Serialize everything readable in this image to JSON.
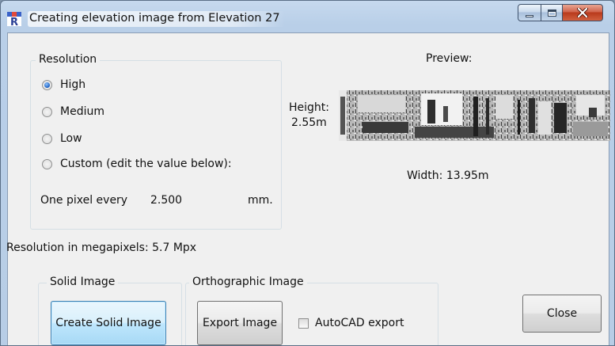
{
  "window": {
    "title": "Creating elevation image from Elevation 27",
    "controls": {
      "minimize": "minimize",
      "maximize": "maximize",
      "close": "close"
    }
  },
  "resolution": {
    "legend": "Resolution",
    "options": [
      {
        "label": "High",
        "selected": true
      },
      {
        "label": "Medium",
        "selected": false
      },
      {
        "label": "Low",
        "selected": false
      },
      {
        "label": "Custom (edit the value below):",
        "selected": false
      }
    ],
    "pixel_label": "One pixel every",
    "pixel_value": "2.500",
    "pixel_unit": "mm."
  },
  "preview": {
    "title": "Preview:",
    "height_label": "Height:",
    "height_value": "2.55m",
    "width_text": "Width: 13.95m"
  },
  "megapixels_text": "Resolution in megapixels: 5.7 Mpx",
  "solid_image": {
    "legend": "Solid Image",
    "button": "Create Solid Image"
  },
  "ortho_image": {
    "legend": "Orthographic Image",
    "button": "Export Image",
    "autocad_label": "AutoCAD export",
    "autocad_checked": false
  },
  "close_button": "Close",
  "colors": {
    "accent": "#1b5fbf",
    "close_red": "#c8472a"
  }
}
